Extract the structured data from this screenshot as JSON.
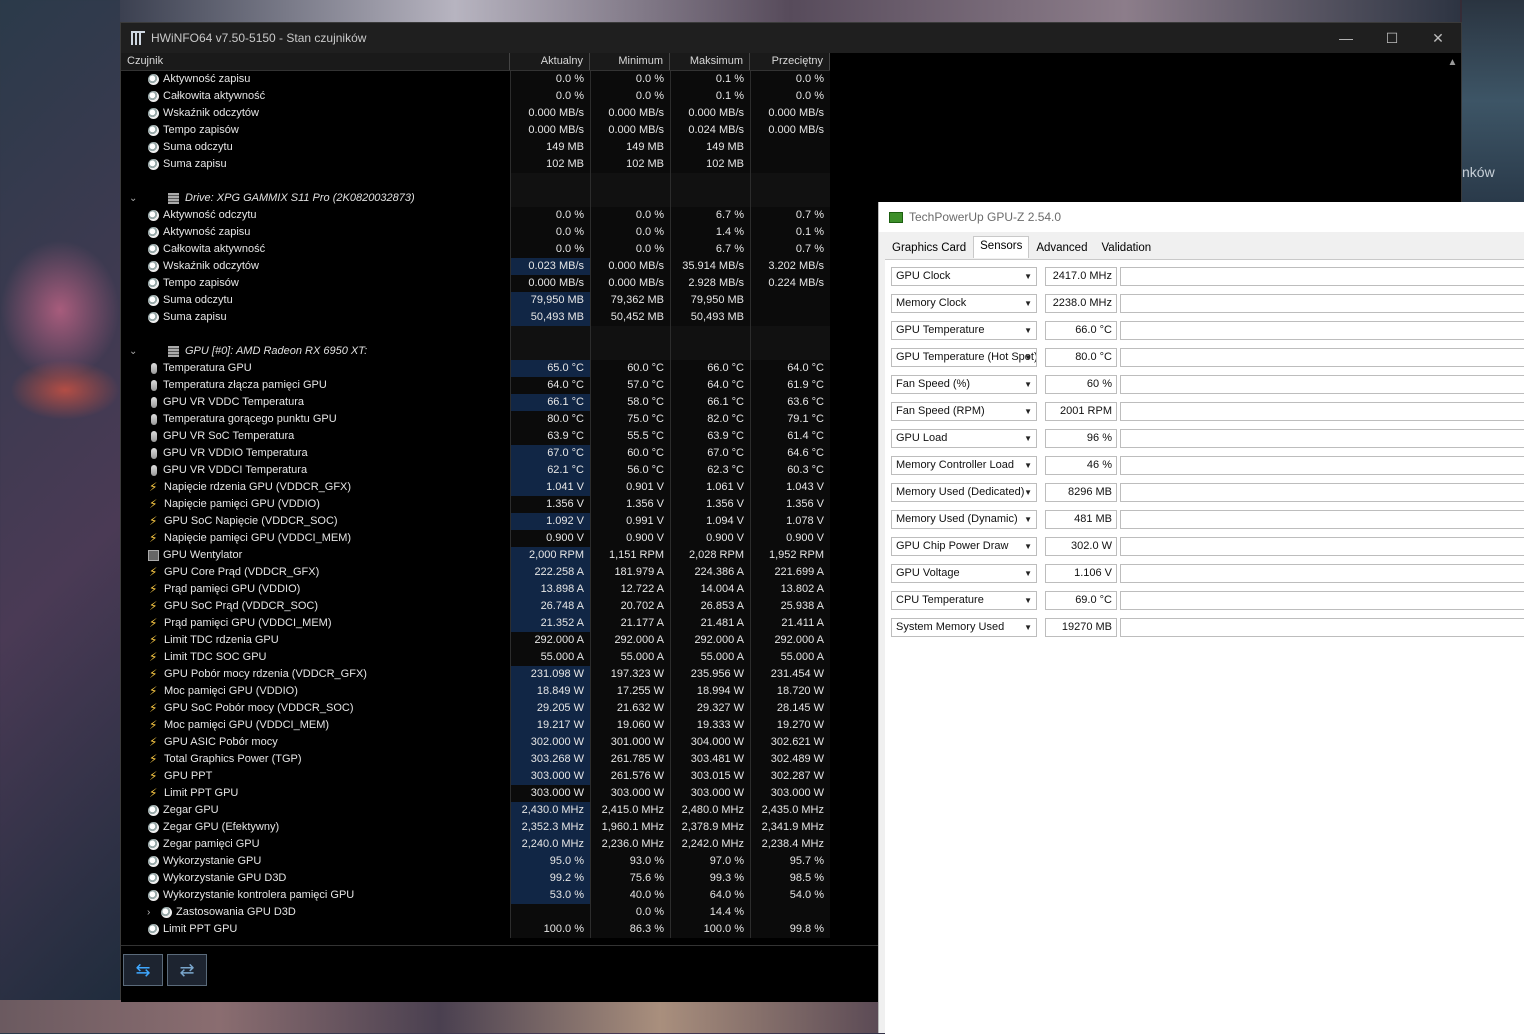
{
  "background": {
    "right_text": "nków"
  },
  "hwinfo": {
    "title": "HWiNFO64 v7.50-5150 - Stan czujników",
    "headers": [
      "Czujnik",
      "Aktualny",
      "Minimum",
      "Maksimum",
      "Przeciętny"
    ],
    "controls": {
      "minimize": "—",
      "maximize": "☐",
      "close": "✕"
    },
    "rows": [
      {
        "type": "sensor",
        "icon": "circle",
        "name": "Aktywność zapisu",
        "v": [
          "0.0 %",
          "0.0 %",
          "0.1 %",
          "0.0 %"
        ]
      },
      {
        "type": "sensor",
        "icon": "circle",
        "name": "Całkowita aktywność",
        "v": [
          "0.0 %",
          "0.0 %",
          "0.1 %",
          "0.0 %"
        ]
      },
      {
        "type": "sensor",
        "icon": "circle",
        "name": "Wskaźnik odczytów",
        "v": [
          "0.000 MB/s",
          "0.000 MB/s",
          "0.000 MB/s",
          "0.000 MB/s"
        ]
      },
      {
        "type": "sensor",
        "icon": "circle",
        "name": "Tempo zapisów",
        "v": [
          "0.000 MB/s",
          "0.000 MB/s",
          "0.024 MB/s",
          "0.000 MB/s"
        ]
      },
      {
        "type": "sensor",
        "icon": "circle",
        "name": "Suma odczytu",
        "v": [
          "149 MB",
          "149 MB",
          "149 MB",
          ""
        ]
      },
      {
        "type": "sensor",
        "icon": "circle",
        "name": "Suma zapisu",
        "v": [
          "102 MB",
          "102 MB",
          "102 MB",
          ""
        ]
      },
      {
        "type": "blank",
        "name": "",
        "v": [
          "",
          "",
          "",
          ""
        ]
      },
      {
        "type": "group",
        "name": "Drive: XPG GAMMIX S11 Pro (2K0820032873)",
        "v": [
          "",
          "",
          "",
          ""
        ]
      },
      {
        "type": "sensor",
        "icon": "circle",
        "name": "Aktywność odczytu",
        "v": [
          "0.0 %",
          "0.0 %",
          "6.7 %",
          "0.7 %"
        ]
      },
      {
        "type": "sensor",
        "icon": "circle",
        "name": "Aktywność zapisu",
        "v": [
          "0.0 %",
          "0.0 %",
          "1.4 %",
          "0.1 %"
        ]
      },
      {
        "type": "sensor",
        "icon": "circle",
        "name": "Całkowita aktywność",
        "v": [
          "0.0 %",
          "0.0 %",
          "6.7 %",
          "0.7 %"
        ]
      },
      {
        "type": "sensor",
        "icon": "circle",
        "name": "Wskaźnik odczytów",
        "hl": true,
        "v": [
          "0.023 MB/s",
          "0.000 MB/s",
          "35.914 MB/s",
          "3.202 MB/s"
        ]
      },
      {
        "type": "sensor",
        "icon": "circle",
        "name": "Tempo zapisów",
        "v": [
          "0.000 MB/s",
          "0.000 MB/s",
          "2.928 MB/s",
          "0.224 MB/s"
        ]
      },
      {
        "type": "sensor",
        "icon": "circle",
        "name": "Suma odczytu",
        "hl": true,
        "v": [
          "79,950 MB",
          "79,362 MB",
          "79,950 MB",
          ""
        ]
      },
      {
        "type": "sensor",
        "icon": "circle",
        "name": "Suma zapisu",
        "hl": true,
        "v": [
          "50,493 MB",
          "50,452 MB",
          "50,493 MB",
          ""
        ]
      },
      {
        "type": "blank",
        "name": "",
        "v": [
          "",
          "",
          "",
          ""
        ]
      },
      {
        "type": "group",
        "name": "GPU [#0]: AMD Radeon RX 6950 XT:",
        "v": [
          "",
          "",
          "",
          ""
        ]
      },
      {
        "type": "sensor",
        "icon": "therm",
        "name": "Temperatura GPU",
        "hl": true,
        "v": [
          "65.0 °C",
          "60.0 °C",
          "66.0 °C",
          "64.0 °C"
        ]
      },
      {
        "type": "sensor",
        "icon": "therm",
        "name": "Temperatura złącza pamięci GPU",
        "v": [
          "64.0 °C",
          "57.0 °C",
          "64.0 °C",
          "61.9 °C"
        ]
      },
      {
        "type": "sensor",
        "icon": "therm",
        "name": "GPU VR VDDC Temperatura",
        "hl": true,
        "v": [
          "66.1 °C",
          "58.0 °C",
          "66.1 °C",
          "63.6 °C"
        ]
      },
      {
        "type": "sensor",
        "icon": "therm",
        "name": "Temperatura gorącego punktu GPU",
        "v": [
          "80.0 °C",
          "75.0 °C",
          "82.0 °C",
          "79.1 °C"
        ]
      },
      {
        "type": "sensor",
        "icon": "therm",
        "name": "GPU VR SoC Temperatura",
        "v": [
          "63.9 °C",
          "55.5 °C",
          "63.9 °C",
          "61.4 °C"
        ]
      },
      {
        "type": "sensor",
        "icon": "therm",
        "name": "GPU VR VDDIO Temperatura",
        "hl": true,
        "v": [
          "67.0 °C",
          "60.0 °C",
          "67.0 °C",
          "64.6 °C"
        ]
      },
      {
        "type": "sensor",
        "icon": "therm",
        "name": "GPU VR VDDCI Temperatura",
        "hl": true,
        "v": [
          "62.1 °C",
          "56.0 °C",
          "62.3 °C",
          "60.3 °C"
        ]
      },
      {
        "type": "sensor",
        "icon": "bolt",
        "name": "Napięcie rdzenia GPU (VDDCR_GFX)",
        "hl": true,
        "v": [
          "1.041 V",
          "0.901 V",
          "1.061 V",
          "1.043 V"
        ]
      },
      {
        "type": "sensor",
        "icon": "bolt",
        "name": "Napięcie pamięci GPU (VDDIO)",
        "v": [
          "1.356 V",
          "1.356 V",
          "1.356 V",
          "1.356 V"
        ]
      },
      {
        "type": "sensor",
        "icon": "bolt",
        "name": "GPU SoC Napięcie (VDDCR_SOC)",
        "hl": true,
        "v": [
          "1.092 V",
          "0.991 V",
          "1.094 V",
          "1.078 V"
        ]
      },
      {
        "type": "sensor",
        "icon": "bolt",
        "name": "Napięcie pamięci GPU (VDDCI_MEM)",
        "v": [
          "0.900 V",
          "0.900 V",
          "0.900 V",
          "0.900 V"
        ]
      },
      {
        "type": "sensor",
        "icon": "fan",
        "name": "GPU Wentylator",
        "hl": true,
        "v": [
          "2,000 RPM",
          "1,151 RPM",
          "2,028 RPM",
          "1,952 RPM"
        ]
      },
      {
        "type": "sensor",
        "icon": "bolt",
        "name": "GPU Core Prąd (VDDCR_GFX)",
        "hl": true,
        "v": [
          "222.258 A",
          "181.979 A",
          "224.386 A",
          "221.699 A"
        ]
      },
      {
        "type": "sensor",
        "icon": "bolt",
        "name": "Prąd pamięci GPU (VDDIO)",
        "hl": true,
        "v": [
          "13.898 A",
          "12.722 A",
          "14.004 A",
          "13.802 A"
        ]
      },
      {
        "type": "sensor",
        "icon": "bolt",
        "name": "GPU SoC Prąd (VDDCR_SOC)",
        "hl": true,
        "v": [
          "26.748 A",
          "20.702 A",
          "26.853 A",
          "25.938 A"
        ]
      },
      {
        "type": "sensor",
        "icon": "bolt",
        "name": "Prąd pamięci GPU (VDDCI_MEM)",
        "hl": true,
        "v": [
          "21.352 A",
          "21.177 A",
          "21.481 A",
          "21.411 A"
        ]
      },
      {
        "type": "sensor",
        "icon": "bolt",
        "name": "Limit TDC rdzenia GPU",
        "v": [
          "292.000 A",
          "292.000 A",
          "292.000 A",
          "292.000 A"
        ]
      },
      {
        "type": "sensor",
        "icon": "bolt",
        "name": "Limit TDC SOC GPU",
        "v": [
          "55.000 A",
          "55.000 A",
          "55.000 A",
          "55.000 A"
        ]
      },
      {
        "type": "sensor",
        "icon": "bolt",
        "name": "GPU Pobór mocy rdzenia (VDDCR_GFX)",
        "hl": true,
        "v": [
          "231.098 W",
          "197.323 W",
          "235.956 W",
          "231.454 W"
        ]
      },
      {
        "type": "sensor",
        "icon": "bolt",
        "name": "Moc pamięci GPU (VDDIO)",
        "hl": true,
        "v": [
          "18.849 W",
          "17.255 W",
          "18.994 W",
          "18.720 W"
        ]
      },
      {
        "type": "sensor",
        "icon": "bolt",
        "name": "GPU SoC Pobór mocy (VDDCR_SOC)",
        "hl": true,
        "v": [
          "29.205 W",
          "21.632 W",
          "29.327 W",
          "28.145 W"
        ]
      },
      {
        "type": "sensor",
        "icon": "bolt",
        "name": "Moc pamięci GPU (VDDCI_MEM)",
        "hl": true,
        "v": [
          "19.217 W",
          "19.060 W",
          "19.333 W",
          "19.270 W"
        ]
      },
      {
        "type": "sensor",
        "icon": "bolt",
        "name": "GPU ASIC Pobór mocy",
        "hl": true,
        "v": [
          "302.000 W",
          "301.000 W",
          "304.000 W",
          "302.621 W"
        ]
      },
      {
        "type": "sensor",
        "icon": "bolt",
        "name": "Total Graphics Power (TGP)",
        "hl": true,
        "v": [
          "303.268 W",
          "261.785 W",
          "303.481 W",
          "302.489 W"
        ]
      },
      {
        "type": "sensor",
        "icon": "bolt",
        "name": "GPU PPT",
        "hl": true,
        "v": [
          "303.000 W",
          "261.576 W",
          "303.015 W",
          "302.287 W"
        ]
      },
      {
        "type": "sensor",
        "icon": "bolt",
        "name": "Limit PPT GPU",
        "v": [
          "303.000 W",
          "303.000 W",
          "303.000 W",
          "303.000 W"
        ]
      },
      {
        "type": "sensor",
        "icon": "circle",
        "name": "Zegar GPU",
        "hl": true,
        "v": [
          "2,430.0 MHz",
          "2,415.0 MHz",
          "2,480.0 MHz",
          "2,435.0 MHz"
        ]
      },
      {
        "type": "sensor",
        "icon": "circle",
        "name": "Zegar GPU (Efektywny)",
        "hl": true,
        "v": [
          "2,352.3 MHz",
          "1,960.1 MHz",
          "2,378.9 MHz",
          "2,341.9 MHz"
        ]
      },
      {
        "type": "sensor",
        "icon": "circle",
        "name": "Zegar pamięci GPU",
        "hl": true,
        "v": [
          "2,240.0 MHz",
          "2,236.0 MHz",
          "2,242.0 MHz",
          "2,238.4 MHz"
        ]
      },
      {
        "type": "sensor",
        "icon": "circle",
        "name": "Wykorzystanie GPU",
        "hl": true,
        "v": [
          "95.0 %",
          "93.0 %",
          "97.0 %",
          "95.7 %"
        ]
      },
      {
        "type": "sensor",
        "icon": "circle",
        "name": "Wykorzystanie GPU D3D",
        "hl": true,
        "v": [
          "99.2 %",
          "75.6 %",
          "99.3 %",
          "98.5 %"
        ]
      },
      {
        "type": "sensor",
        "icon": "circle",
        "name": "Wykorzystanie kontrolera pamięci GPU",
        "hl": true,
        "v": [
          "53.0 %",
          "40.0 %",
          "64.0 %",
          "54.0 %"
        ]
      },
      {
        "type": "sub",
        "icon": "circle",
        "name": "Zastosowania GPU D3D",
        "v": [
          "",
          "0.0 %",
          "14.4 %",
          ""
        ]
      },
      {
        "type": "sensor",
        "icon": "circle",
        "name": "Limit PPT GPU",
        "v": [
          "100.0 %",
          "86.3 %",
          "100.0 %",
          "99.8 %"
        ]
      }
    ],
    "nav": {
      "back_forward": "⇆",
      "collapse": "⇄"
    }
  },
  "gpuz": {
    "title": "TechPowerUp GPU-Z 2.54.0",
    "tabs": [
      "Graphics Card",
      "Sensors",
      "Advanced",
      "Validation"
    ],
    "active_tab": "Sensors",
    "sensors": [
      {
        "label": "GPU Clock",
        "value": "2417.0 MHz"
      },
      {
        "label": "Memory Clock",
        "value": "2238.0 MHz"
      },
      {
        "label": "GPU Temperature",
        "value": "66.0 °C"
      },
      {
        "label": "GPU Temperature (Hot Spot)",
        "value": "80.0 °C"
      },
      {
        "label": "Fan Speed (%)",
        "value": "60 %"
      },
      {
        "label": "Fan Speed (RPM)",
        "value": "2001 RPM"
      },
      {
        "label": "GPU Load",
        "value": "96 %"
      },
      {
        "label": "Memory Controller Load",
        "value": "46 %"
      },
      {
        "label": "Memory Used (Dedicated)",
        "value": "8296 MB"
      },
      {
        "label": "Memory Used (Dynamic)",
        "value": "481 MB"
      },
      {
        "label": "GPU Chip Power Draw",
        "value": "302.0 W"
      },
      {
        "label": "GPU Voltage",
        "value": "1.106 V"
      },
      {
        "label": "CPU Temperature",
        "value": "69.0 °C"
      },
      {
        "label": "System Memory Used",
        "value": "19270 MB"
      }
    ]
  }
}
